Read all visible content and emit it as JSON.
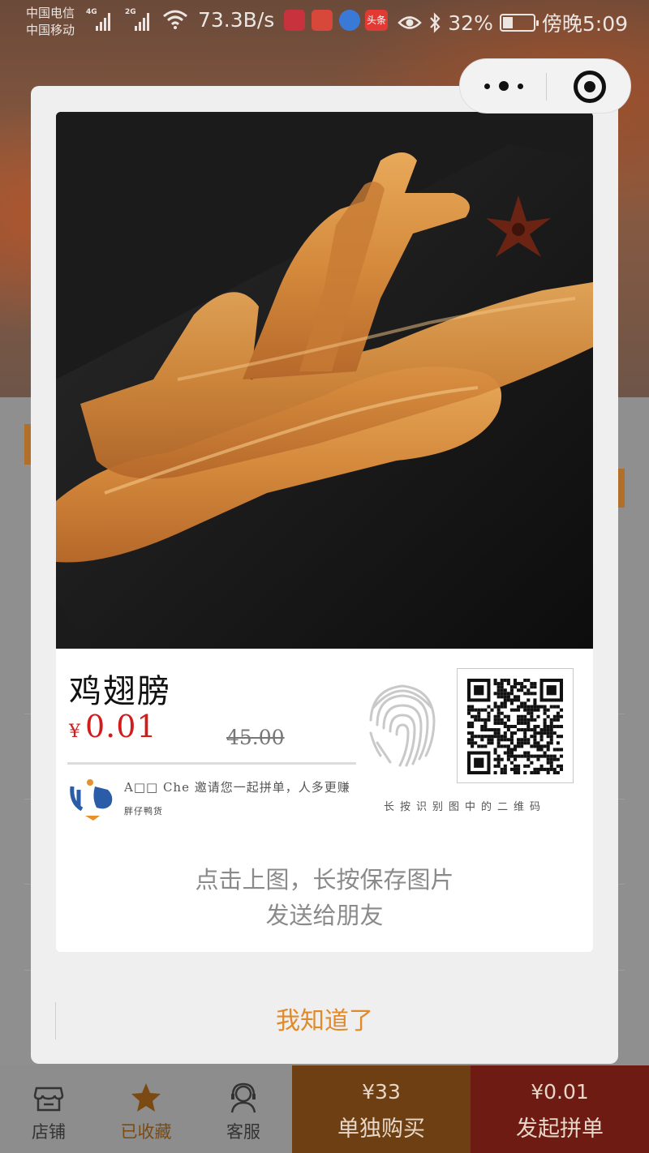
{
  "status_bar": {
    "carrier_1": "中国电信",
    "carrier_2": "中国移动",
    "net_1": "4G",
    "net_2": "2G",
    "speed": "73.3B/s",
    "news_app": "头条",
    "battery": "32%",
    "time": "傍晚5:09"
  },
  "poster": {
    "title": "鸡翅膀",
    "currency": "¥",
    "price": "0.01",
    "original_price": "45.00",
    "invite_text": "A□□ Che 邀请您一起拼单，人多更赚",
    "shop_name": "胖仔鸭货",
    "qr_hint": "长按识别图中的二维码"
  },
  "modal": {
    "tip_line_1": "点击上图，长按保存图片",
    "tip_line_2": "发送给朋友",
    "confirm_label": "我知道了"
  },
  "tabbar": {
    "store_label": "店铺",
    "favorite_label": "已收藏",
    "service_label": "客服",
    "single_price": "¥33",
    "single_label": "单独购买",
    "group_price": "¥0.01",
    "group_label": "发起拼单"
  },
  "colors": {
    "price_red": "#d21c1c",
    "accent_orange": "#e08a2a",
    "single_buy_bg": "#6e3f12",
    "group_buy_bg": "#6e1b14"
  },
  "icons": {
    "store": "store-icon",
    "favorite": "star-icon",
    "service": "headset-icon",
    "more": "more-dots-icon",
    "close": "target-close-icon",
    "fingerprint": "fingerprint-icon",
    "qr": "qr-code"
  }
}
